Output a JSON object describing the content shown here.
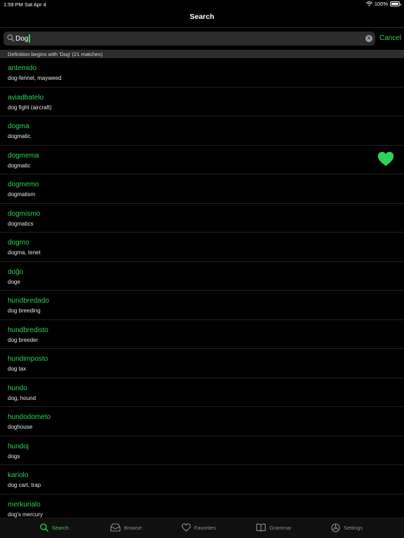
{
  "status": {
    "time": "1:59 PM",
    "date": "Sat Apr 4",
    "battery": "100%",
    "battery_level": 1.0
  },
  "nav": {
    "title": "Search"
  },
  "search": {
    "query": "Dog",
    "cancel_label": "Cancel",
    "icon": "search-icon",
    "clear_icon": "clear-icon"
  },
  "section": {
    "header": "Definition begins with 'Dog' (21 matches)"
  },
  "results": [
    {
      "term": "antemido",
      "definition": "dog-fennel, mayweed",
      "favorite": false
    },
    {
      "term": "aviadbatelo",
      "definition": "dog fight (aircraft)",
      "favorite": false
    },
    {
      "term": "dogma",
      "definition": "dogmatic",
      "favorite": false
    },
    {
      "term": "dogmema",
      "definition": "dogmatic",
      "favorite": true
    },
    {
      "term": "dogmemo",
      "definition": "dogmatism",
      "favorite": false
    },
    {
      "term": "dogmismo",
      "definition": "dogmatics",
      "favorite": false
    },
    {
      "term": "dogmo",
      "definition": "dogma, tenet",
      "favorite": false
    },
    {
      "term": "doĝo",
      "definition": "doge",
      "favorite": false
    },
    {
      "term": "hundbredado",
      "definition": "dog breeding",
      "favorite": false
    },
    {
      "term": "hundbredisto",
      "definition": "dog breeder",
      "favorite": false
    },
    {
      "term": "hundimposto",
      "definition": "dog tax",
      "favorite": false
    },
    {
      "term": "hundo",
      "definition": "dog, hound",
      "favorite": false
    },
    {
      "term": "hundodometo",
      "definition": "doghouse",
      "favorite": false
    },
    {
      "term": "hundoj",
      "definition": "dogs",
      "favorite": false
    },
    {
      "term": "kariolo",
      "definition": "dog cart, trap",
      "favorite": false
    },
    {
      "term": "merkurialo",
      "definition": "dog's mercury",
      "favorite": false
    }
  ],
  "tabs": [
    {
      "label": "Search",
      "icon": "search-icon",
      "active": true
    },
    {
      "label": "Browse",
      "icon": "inbox-icon",
      "active": false
    },
    {
      "label": "Favorites",
      "icon": "heart-icon",
      "active": false
    },
    {
      "label": "Grammar",
      "icon": "book-icon",
      "active": false
    },
    {
      "label": "Settings",
      "icon": "gear-icon",
      "active": false
    }
  ],
  "colors": {
    "accent": "#30d158",
    "background": "#000000",
    "search_field": "#2b2b2d",
    "section_header": "#2c2c2e",
    "inactive_tab": "#8e8e93"
  }
}
